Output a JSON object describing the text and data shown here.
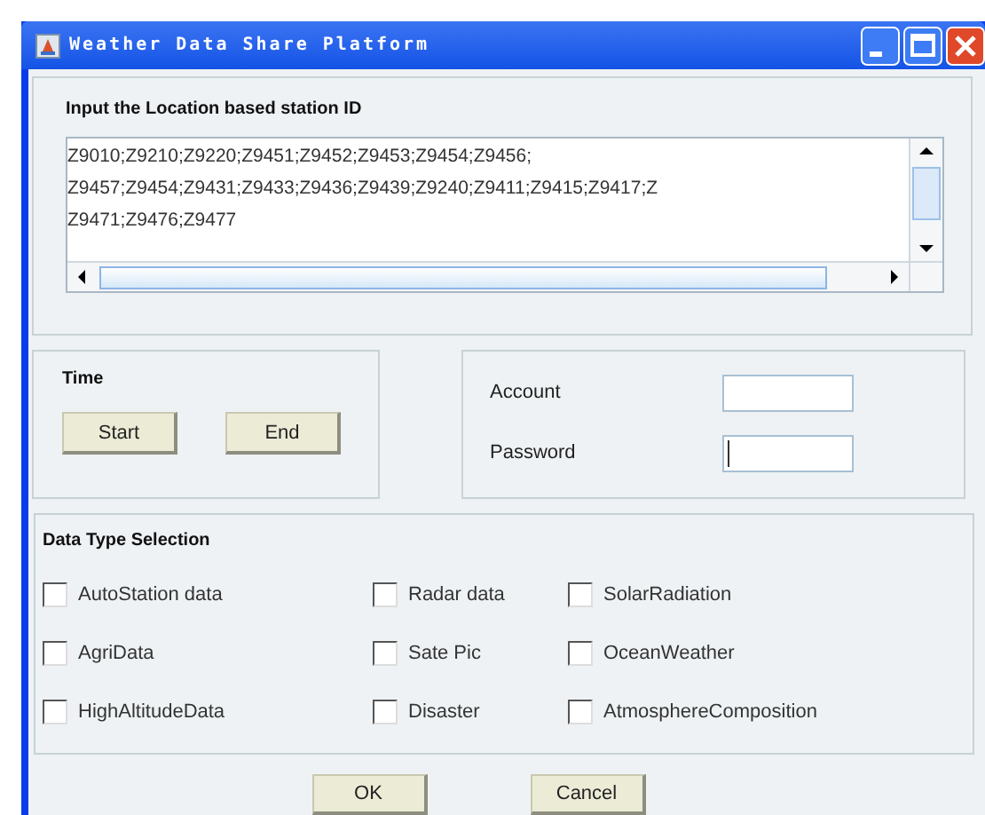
{
  "window": {
    "title": "Weather Data Share Platform"
  },
  "station_panel": {
    "label": "Input the Location based station ID",
    "value": "Z9010;Z9210;Z9220;Z9451;Z9452;Z9453;Z9454;Z9456;\nZ9457;Z9454;Z9431;Z9433;Z9436;Z9439;Z9240;Z9411;Z9415;Z9417;Z\nZ9471;Z9476;Z9477"
  },
  "time_panel": {
    "title": "Time",
    "buttons": [
      "Start",
      "End"
    ]
  },
  "login_panel": {
    "fields": [
      {
        "label": "Account"
      },
      {
        "label": "Password"
      }
    ]
  },
  "data_type_panel": {
    "title": "Data Type Selection",
    "options": [
      {
        "label": "AutoStation data",
        "checked": false
      },
      {
        "label": "Radar data",
        "checked": false
      },
      {
        "label": "SolarRadiation",
        "checked": false
      },
      {
        "label": "AgriData",
        "checked": false
      },
      {
        "label": "Sate Pic",
        "checked": false
      },
      {
        "label": "OceanWeather",
        "checked": false
      },
      {
        "label": "HighAltitudeData",
        "checked": false
      },
      {
        "label": "Disaster",
        "checked": false
      },
      {
        "label": "AtmosphereComposition",
        "checked": false
      }
    ]
  },
  "buttons": [
    "OK",
    "Cancel"
  ]
}
